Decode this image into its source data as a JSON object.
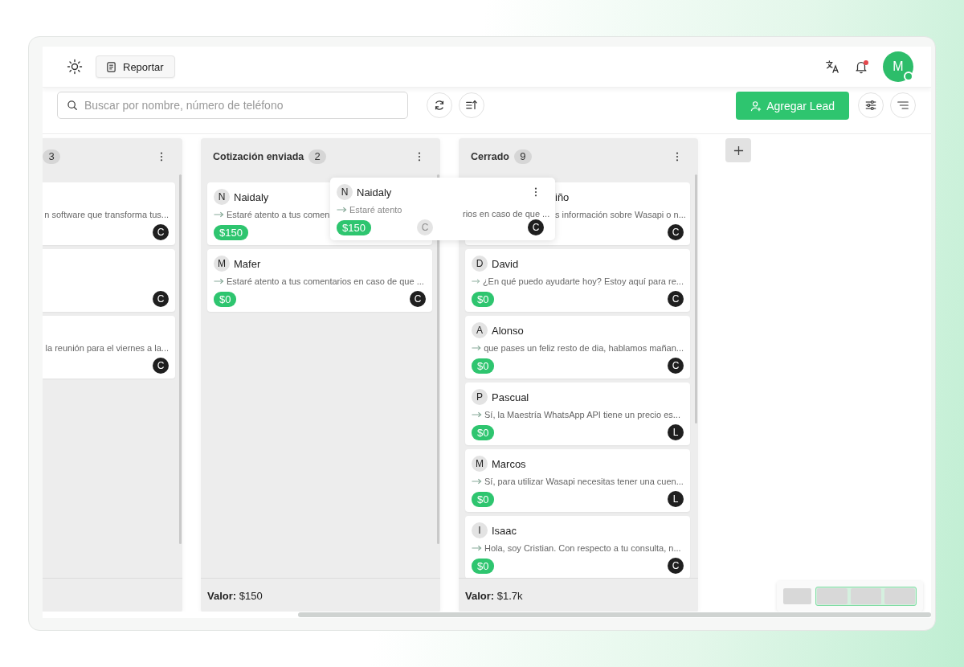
{
  "header": {
    "report_button": "Reportar",
    "avatar_initial": "M",
    "notification": true,
    "online": true
  },
  "search": {
    "placeholder": "Buscar por nombre, número de teléfono"
  },
  "add_button": "Agregar Lead",
  "columns": [
    {
      "kind": "clipped",
      "count": "3",
      "cards": [
        {
          "kind": "clipped",
          "message": "n software que transforma tus...",
          "agent": "C"
        },
        {
          "kind": "clipped",
          "agent": "C"
        },
        {
          "kind": "clipped",
          "message": "la reunión para el viernes a la...",
          "agent": "C"
        }
      ]
    },
    {
      "kind": "full",
      "title": "Cotización enviada",
      "count": "2",
      "value_label": "Valor:",
      "value": "$150",
      "cards": [
        {
          "kind": "under-ghost",
          "initial": "N",
          "name": "Naidaly",
          "message": "Estaré atento a tus comen",
          "amount": "$150"
        },
        {
          "kind": "normal",
          "initial": "M",
          "name": "Mafer",
          "message": "Estaré atento a tus comentarios en caso de que ...",
          "amount": "$0",
          "agent": "C"
        }
      ]
    },
    {
      "kind": "full",
      "title": "Cerrado",
      "count": "9",
      "value_label": "Valor:",
      "value": "$1.7k",
      "cards": [
        {
          "kind": "covered",
          "name": "iño",
          "message": "s información sobre Wasapi o n...",
          "agent": "C"
        },
        {
          "kind": "normal",
          "initial": "D",
          "name": "David",
          "message": "¿En qué puedo ayudarte hoy? Estoy aquí para re...",
          "amount": "$0",
          "agent": "C"
        },
        {
          "kind": "normal",
          "initial": "A",
          "name": "Alonso",
          "message": "que pases un feliz resto de dia, hablamos mañan...",
          "amount": "$0",
          "agent": "C"
        },
        {
          "kind": "normal",
          "initial": "P",
          "name": "Pascual",
          "message": "Sí, la Maestría WhatsApp API tiene un precio es...",
          "amount": "$0",
          "agent": "L"
        },
        {
          "kind": "normal",
          "initial": "M",
          "name": "Marcos",
          "message": "Sí, para utilizar Wasapi necesitas tener una cuen...",
          "amount": "$0",
          "agent": "L"
        },
        {
          "kind": "normal",
          "initial": "I",
          "name": "Isaac",
          "message": "Hola, soy Cristian. Con respecto a tu consulta, n...",
          "amount": "$0",
          "agent": "C"
        }
      ]
    }
  ],
  "drag_card": {
    "initial": "N",
    "name": "Naidaly",
    "message": "Estaré atento",
    "amount": "$150",
    "faded_agent": "C",
    "trail_message": "rios en caso de que ...",
    "agent": "C"
  }
}
